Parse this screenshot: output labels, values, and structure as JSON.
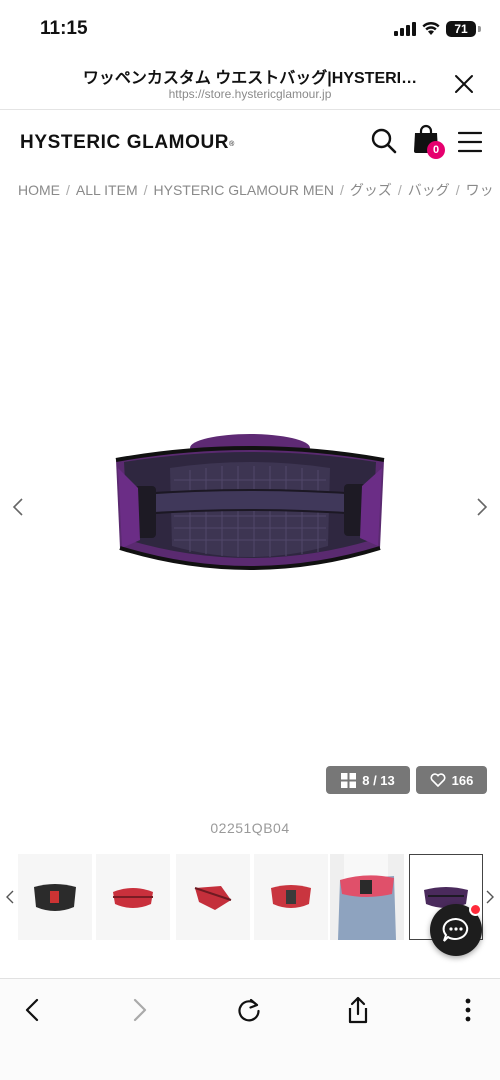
{
  "status": {
    "time": "11:15",
    "battery": "71"
  },
  "browser": {
    "page_title": "ワッペンカスタム ウエストバッグ|HYSTERI…",
    "url": "https://store.hystericglamour.jp"
  },
  "site": {
    "logo": "HYSTERIC GLAMOUR",
    "logo_mark": "®",
    "cart_count": "0"
  },
  "breadcrumb": [
    "HOME",
    "ALL ITEM",
    "HYSTERIC GLAMOUR MEN",
    "グッズ",
    "バッグ",
    "ワッ"
  ],
  "gallery": {
    "counter": "8 / 13",
    "current": 8,
    "total": 13,
    "likes": "166"
  },
  "product": {
    "code": "02251QB04"
  },
  "thumbnails": [
    {
      "name": "thumb-black-bag",
      "color": "#2b2b2b"
    },
    {
      "name": "thumb-red-bag",
      "color": "#c9303c"
    },
    {
      "name": "thumb-red-bag-side",
      "color": "#c42f3b"
    },
    {
      "name": "thumb-red-bag-back",
      "color": "#c9353f"
    },
    {
      "name": "thumb-model-red",
      "color": "#e0506a"
    },
    {
      "name": "thumb-purple-bag",
      "color": "#4a2a5c"
    }
  ],
  "colors": {
    "accent": "#e6006e",
    "button_bg": "#777777",
    "bag_purple": "#5e2a74"
  }
}
